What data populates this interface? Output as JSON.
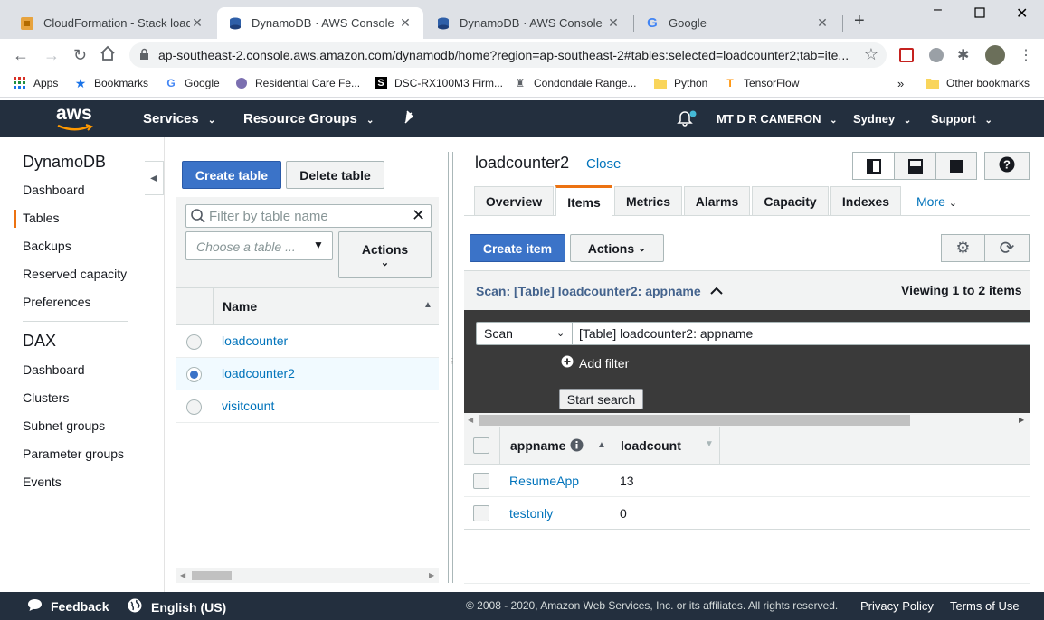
{
  "browser": {
    "tabs": [
      {
        "title": "CloudFormation - Stack loadco",
        "icon": "cloudformation-icon"
      },
      {
        "title": "DynamoDB · AWS Console",
        "icon": "dynamodb-icon"
      },
      {
        "title": "DynamoDB · AWS Console",
        "icon": "dynamodb-icon"
      },
      {
        "title": "Google",
        "icon": "google-icon"
      }
    ],
    "url": "ap-southeast-2.console.aws.amazon.com/dynamodb/home?region=ap-southeast-2#tables:selected=loadcounter2;tab=ite...",
    "bookmarks": [
      "Apps",
      "Bookmarks",
      "Google",
      "Residential Care Fe...",
      "DSC-RX100M3 Firm...",
      "Condondale Range...",
      "Python",
      "TensorFlow"
    ],
    "other_bookmarks": "Other bookmarks"
  },
  "aws_header": {
    "logo": "aws",
    "services": "Services",
    "resource_groups": "Resource Groups",
    "user": "MT D R CAMERON",
    "region": "Sydney",
    "support": "Support"
  },
  "left_nav": {
    "dynamodb_heading": "DynamoDB",
    "dynamodb_items": [
      "Dashboard",
      "Tables",
      "Backups",
      "Reserved capacity",
      "Preferences"
    ],
    "dax_heading": "DAX",
    "dax_items": [
      "Dashboard",
      "Clusters",
      "Subnet groups",
      "Parameter groups",
      "Events"
    ]
  },
  "tables_panel": {
    "create_table": "Create table",
    "delete_table": "Delete table",
    "filter_placeholder": "Filter by table name",
    "choose_table_placeholder": "Choose a table ...",
    "actions": "Actions",
    "name_header": "Name",
    "tables": [
      "loadcounter",
      "loadcounter2",
      "visitcount"
    ],
    "selected_index": 1
  },
  "details": {
    "table_name": "loadcounter2",
    "close": "Close",
    "tabs": [
      "Overview",
      "Items",
      "Metrics",
      "Alarms",
      "Capacity",
      "Indexes"
    ],
    "more": "More",
    "create_item": "Create item",
    "actions": "Actions",
    "scan_title": "Scan: [Table] loadcounter2: appname",
    "viewing": "Viewing 1 to 2 items",
    "scan_select": "Scan",
    "scan_target": "[Table] loadcounter2: appname",
    "add_filter": "Add filter",
    "start_search": "Start search",
    "columns": [
      "appname",
      "loadcount"
    ],
    "rows": [
      {
        "appname": "ResumeApp",
        "loadcount": "13"
      },
      {
        "appname": "testonly",
        "loadcount": "0"
      }
    ]
  },
  "footer": {
    "feedback": "Feedback",
    "language": "English (US)",
    "copyright": "© 2008 - 2020, Amazon Web Services, Inc. or its affiliates. All rights reserved.",
    "privacy": "Privacy Policy",
    "terms": "Terms of Use"
  }
}
